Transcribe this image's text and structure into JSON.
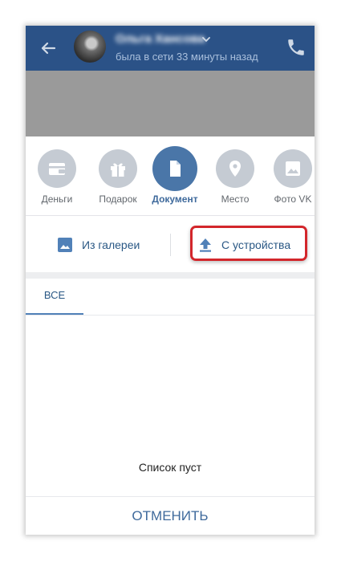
{
  "header": {
    "contact_name": "Ольга Хансова",
    "status": "была в сети 33 минуты назад",
    "back_icon": "arrow-left-icon",
    "call_icon": "phone-icon",
    "background_color": "#2b5287"
  },
  "attachments": {
    "items": [
      {
        "label": "Деньги",
        "icon": "wallet-icon"
      },
      {
        "label": "Подарок",
        "icon": "gift-icon"
      },
      {
        "label": "Документ",
        "icon": "document-icon",
        "active": true
      },
      {
        "label": "Место",
        "icon": "location-pin-icon"
      },
      {
        "label": "Фото VK",
        "icon": "image-icon"
      }
    ],
    "active_color": "#4a76a8",
    "inactive_color": "#c5cbd3"
  },
  "source": {
    "gallery_label": "Из галереи",
    "device_label": "С устройства",
    "highlight_color": "#d3262b"
  },
  "tabs": {
    "all_label": "ВСЕ"
  },
  "empty_message": "Список пуст",
  "cancel_label": "ОТМЕНИТЬ"
}
